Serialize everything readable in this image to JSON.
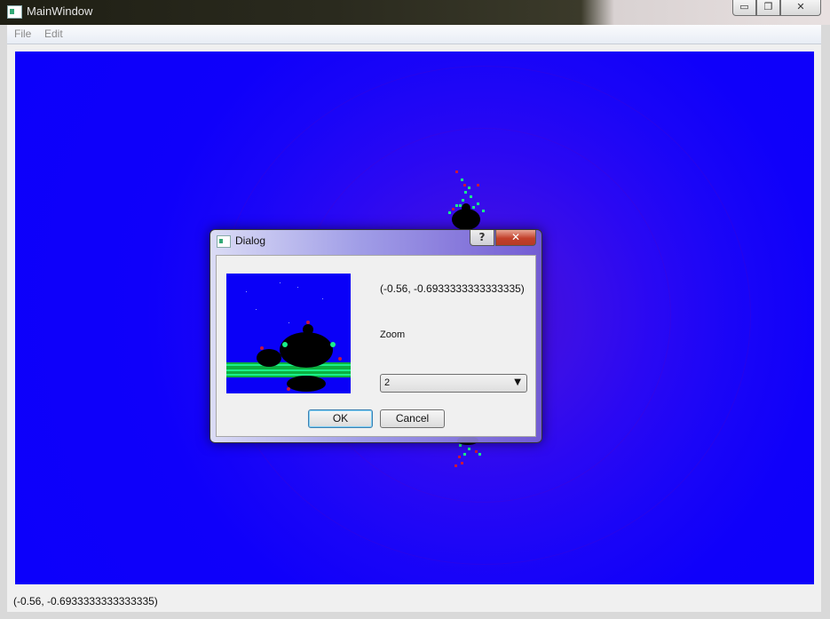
{
  "window": {
    "title": "MainWindow",
    "minimize_glyph": "▭",
    "maximize_glyph": "❐",
    "close_glyph": "✕"
  },
  "menu": {
    "items": [
      {
        "label": "File"
      },
      {
        "label": "Edit"
      }
    ]
  },
  "statusbar": {
    "text": "(-0.56, -0.6933333333333335)"
  },
  "dialog": {
    "title": "Dialog",
    "help_glyph": "?",
    "close_glyph": "✕",
    "coordinates": "(-0.56, -0.6933333333333335)",
    "zoom_label": "Zoom",
    "zoom_value": "2",
    "ok_label": "OK",
    "cancel_label": "Cancel"
  },
  "colors": {
    "canvas_blue": "#0c00fb",
    "fractal_black": "#000000",
    "fractal_green": "#19f08a",
    "fractal_red": "#c8183c"
  }
}
